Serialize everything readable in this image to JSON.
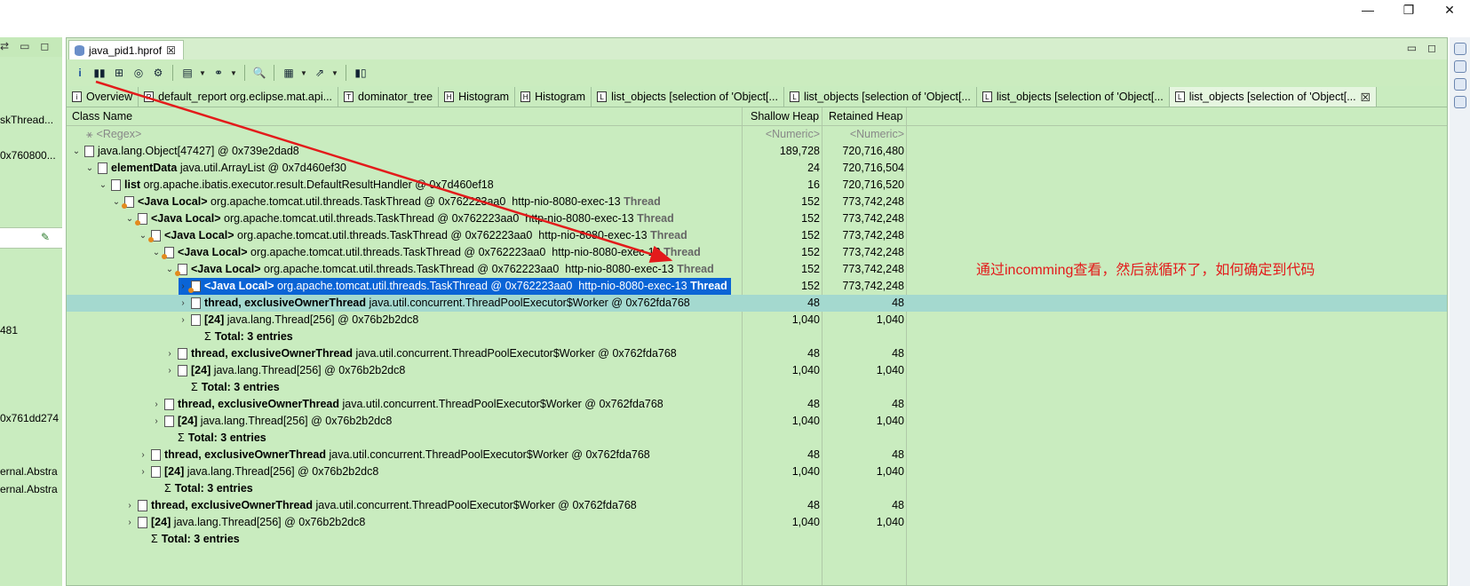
{
  "window": {
    "minimize": "—",
    "restore": "❐",
    "close": "✕"
  },
  "left_view": {
    "lines": [
      "skThread...",
      "0x760800...",
      "481",
      "0x761dd274",
      "ernal.Abstra",
      "ernal.Abstra"
    ]
  },
  "editor": {
    "tab_label": "java_pid1.hprof",
    "tab_close": "☒"
  },
  "subtabs": [
    {
      "icon": "i",
      "label": "Overview"
    },
    {
      "icon": "R",
      "label": "default_report  org.eclipse.mat.api..."
    },
    {
      "icon": "T",
      "label": "dominator_tree"
    },
    {
      "icon": "H",
      "label": "Histogram"
    },
    {
      "icon": "H",
      "label": "Histogram"
    },
    {
      "icon": "L",
      "label": "list_objects   [selection of 'Object[..."
    },
    {
      "icon": "L",
      "label": "list_objects   [selection of 'Object[..."
    },
    {
      "icon": "L",
      "label": "list_objects   [selection of 'Object[..."
    },
    {
      "icon": "L",
      "label": "list_objects   [selection of 'Object[...",
      "close": "☒"
    }
  ],
  "table": {
    "headers": {
      "name": "Class Name",
      "shallow": "Shallow Heap",
      "retained": "Retained Heap"
    },
    "regex_row": {
      "name": "<Regex>",
      "shallow": "<Numeric>",
      "retained": "<Numeric>"
    },
    "rows": [
      {
        "bold": "",
        "name": "java.lang.Object[47427] @ 0x739e2dad8",
        "suffix": "",
        "shallow": "189,728",
        "retained": "720,716,480"
      },
      {
        "bold": "elementData",
        "name": " java.util.ArrayList @ 0x7d460ef30",
        "suffix": "",
        "shallow": "24",
        "retained": "720,716,504"
      },
      {
        "bold": "list",
        "name": " org.apache.ibatis.executor.result.DefaultResultHandler @ 0x7d460ef18",
        "suffix": "",
        "shallow": "16",
        "retained": "720,716,520"
      },
      {
        "bold": "<Java Local>",
        "name": " org.apache.tomcat.util.threads.TaskThread @ 0x762223aa0  http-nio-8080-exec-13 ",
        "suffix": "Thread",
        "shallow": "152",
        "retained": "773,742,248"
      },
      {
        "bold": "<Java Local>",
        "name": " org.apache.tomcat.util.threads.TaskThread @ 0x762223aa0  http-nio-8080-exec-13 ",
        "suffix": "Thread",
        "shallow": "152",
        "retained": "773,742,248"
      },
      {
        "bold": "<Java Local>",
        "name": " org.apache.tomcat.util.threads.TaskThread @ 0x762223aa0  http-nio-8080-exec-13 ",
        "suffix": "Thread",
        "shallow": "152",
        "retained": "773,742,248"
      },
      {
        "bold": "<Java Local>",
        "name": " org.apache.tomcat.util.threads.TaskThread @ 0x762223aa0  http-nio-8080-exec-13 ",
        "suffix": "Thread",
        "shallow": "152",
        "retained": "773,742,248"
      },
      {
        "bold": "<Java Local>",
        "name": " org.apache.tomcat.util.threads.TaskThread @ 0x762223aa0  http-nio-8080-exec-13 ",
        "suffix": "Thread",
        "shallow": "152",
        "retained": "773,742,248"
      },
      {
        "bold": "<Java Local>",
        "name": " org.apache.tomcat.util.threads.TaskThread @ 0x762223aa0  http-nio-8080-exec-13 ",
        "suffix": "Thread",
        "shallow": "152",
        "retained": "773,742,248"
      },
      {
        "bold": "thread, exclusiveOwnerThread",
        "name": " java.util.concurrent.ThreadPoolExecutor$Worker @ 0x762fda768",
        "suffix": "",
        "shallow": "48",
        "retained": "48"
      },
      {
        "bold": "[24]",
        "name": " java.lang.Thread[256] @ 0x76b2b2dc8",
        "suffix": "",
        "shallow": "1,040",
        "retained": "1,040"
      },
      {
        "bold": "Total: 3 entries",
        "name": "",
        "suffix": "",
        "shallow": "",
        "retained": ""
      },
      {
        "bold": "thread, exclusiveOwnerThread",
        "name": " java.util.concurrent.ThreadPoolExecutor$Worker @ 0x762fda768",
        "suffix": "",
        "shallow": "48",
        "retained": "48"
      },
      {
        "bold": "[24]",
        "name": " java.lang.Thread[256] @ 0x76b2b2dc8",
        "suffix": "",
        "shallow": "1,040",
        "retained": "1,040"
      },
      {
        "bold": "Total: 3 entries",
        "name": "",
        "suffix": "",
        "shallow": "",
        "retained": ""
      },
      {
        "bold": "thread, exclusiveOwnerThread",
        "name": " java.util.concurrent.ThreadPoolExecutor$Worker @ 0x762fda768",
        "suffix": "",
        "shallow": "48",
        "retained": "48"
      },
      {
        "bold": "[24]",
        "name": " java.lang.Thread[256] @ 0x76b2b2dc8",
        "suffix": "",
        "shallow": "1,040",
        "retained": "1,040"
      },
      {
        "bold": "Total: 3 entries",
        "name": "",
        "suffix": "",
        "shallow": "",
        "retained": ""
      },
      {
        "bold": "thread, exclusiveOwnerThread",
        "name": " java.util.concurrent.ThreadPoolExecutor$Worker @ 0x762fda768",
        "suffix": "",
        "shallow": "48",
        "retained": "48"
      },
      {
        "bold": "[24]",
        "name": " java.lang.Thread[256] @ 0x76b2b2dc8",
        "suffix": "",
        "shallow": "1,040",
        "retained": "1,040"
      },
      {
        "bold": "Total: 3 entries",
        "name": "",
        "suffix": "",
        "shallow": "",
        "retained": ""
      },
      {
        "bold": "thread, exclusiveOwnerThread",
        "name": " java.util.concurrent.ThreadPoolExecutor$Worker @ 0x762fda768",
        "suffix": "",
        "shallow": "48",
        "retained": "48"
      },
      {
        "bold": "[24]",
        "name": " java.lang.Thread[256] @ 0x76b2b2dc8",
        "suffix": "",
        "shallow": "1,040",
        "retained": "1,040"
      },
      {
        "bold": "Total: 3 entries",
        "name": "",
        "suffix": "",
        "shallow": "",
        "retained": ""
      }
    ]
  },
  "annotation": "通过incomming查看，然后就循环了，如何确定到代码",
  "colors": {
    "background": "#c9ecbf",
    "selection": "#0a64d6",
    "highlight": "#a4d9cf",
    "annotation": "#e31b1b"
  }
}
